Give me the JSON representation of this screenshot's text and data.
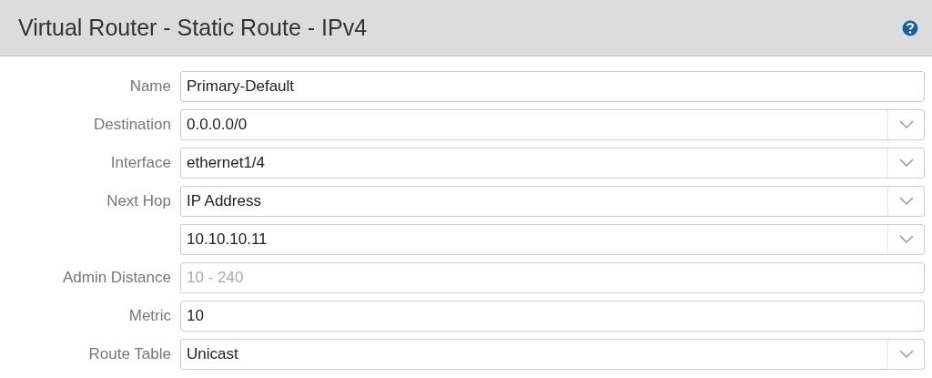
{
  "window": {
    "title": "Virtual Router - Static Route - IPv4"
  },
  "fields": [
    {
      "label": "Name",
      "kind": "text",
      "value": "Primary-Default"
    },
    {
      "label": "Destination",
      "kind": "select",
      "value": "0.0.0.0/0"
    },
    {
      "label": "Interface",
      "kind": "select",
      "value": "ethernet1/4"
    },
    {
      "label": "Next Hop",
      "kind": "select",
      "value": "IP Address"
    },
    {
      "kind": "select",
      "value": "10.10.10.11"
    },
    {
      "label": "Admin Distance",
      "kind": "text",
      "placeholder": "10 - 240"
    },
    {
      "label": "Metric",
      "kind": "text",
      "value": "10"
    },
    {
      "label": "Route Table",
      "kind": "select",
      "value": "Unicast"
    }
  ]
}
